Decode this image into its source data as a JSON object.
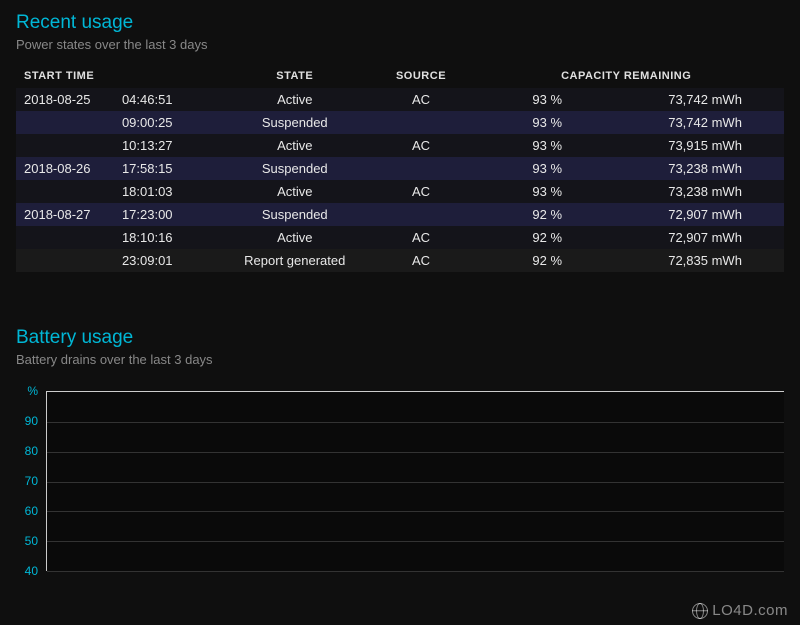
{
  "recent_usage": {
    "title": "Recent usage",
    "subtitle": "Power states over the last 3 days",
    "headers": {
      "start_time": "START TIME",
      "state": "STATE",
      "source": "SOURCE",
      "capacity": "CAPACITY REMAINING"
    },
    "rows": [
      {
        "date": "2018-08-25",
        "time": "04:46:51",
        "state": "Active",
        "source": "AC",
        "pct": "93 %",
        "mwh": "73,742 mWh",
        "css": "row-dark"
      },
      {
        "date": "",
        "time": "09:00:25",
        "state": "Suspended",
        "source": "",
        "pct": "93 %",
        "mwh": "73,742 mWh",
        "css": "row-blue"
      },
      {
        "date": "",
        "time": "10:13:27",
        "state": "Active",
        "source": "AC",
        "pct": "93 %",
        "mwh": "73,915 mWh",
        "css": "row-dark"
      },
      {
        "date": "2018-08-26",
        "time": "17:58:15",
        "state": "Suspended",
        "source": "",
        "pct": "93 %",
        "mwh": "73,238 mWh",
        "css": "row-blue"
      },
      {
        "date": "",
        "time": "18:01:03",
        "state": "Active",
        "source": "AC",
        "pct": "93 %",
        "mwh": "73,238 mWh",
        "css": "row-dark"
      },
      {
        "date": "2018-08-27",
        "time": "17:23:00",
        "state": "Suspended",
        "source": "",
        "pct": "92 %",
        "mwh": "72,907 mWh",
        "css": "row-blue"
      },
      {
        "date": "",
        "time": "18:10:16",
        "state": "Active",
        "source": "AC",
        "pct": "92 %",
        "mwh": "72,907 mWh",
        "css": "row-dark"
      },
      {
        "date": "",
        "time": "23:09:01",
        "state": "Report generated",
        "source": "AC",
        "pct": "92 %",
        "mwh": "72,835 mWh",
        "css": "row-light"
      }
    ]
  },
  "battery_usage": {
    "title": "Battery usage",
    "subtitle": "Battery drains over the last 3 days"
  },
  "chart_data": {
    "type": "bar",
    "title": "Battery usage",
    "xlabel": "",
    "ylabel": "%",
    "ylim": [
      40,
      100
    ],
    "y_ticks": [
      "%",
      "90",
      "80",
      "70",
      "60",
      "50",
      "40"
    ],
    "categories": [],
    "values": []
  },
  "watermark": {
    "text": "LO4D.com"
  }
}
